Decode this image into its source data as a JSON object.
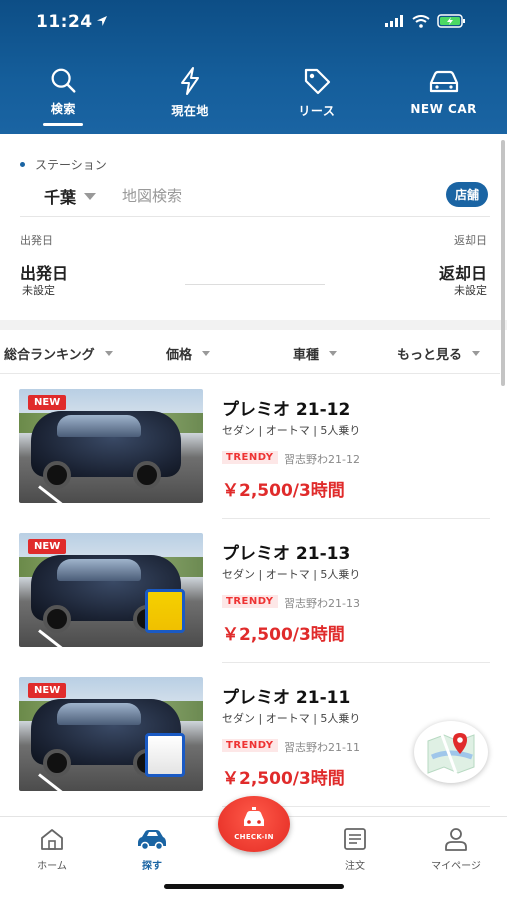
{
  "status_bar": {
    "time": "11:24"
  },
  "top_tabs": [
    {
      "label": "検索",
      "icon": "search-icon",
      "active": true
    },
    {
      "label": "現在地",
      "icon": "lightning-icon",
      "active": false
    },
    {
      "label": "リース",
      "icon": "tag-icon",
      "active": false
    },
    {
      "label": "NEW CAR",
      "icon": "car-icon",
      "active": false
    }
  ],
  "search": {
    "station_label": "ステーション",
    "city": "千葉",
    "map_search": "地図検索",
    "store_button": "店舗",
    "departure_label": "出発日",
    "return_label": "返却日",
    "departure_value": "出発日",
    "return_value": "返却日",
    "departure_sub": "未設定",
    "return_sub": "未設定"
  },
  "filters": [
    {
      "label": "総合ランキング"
    },
    {
      "label": "価格"
    },
    {
      "label": "車種"
    },
    {
      "label": "もっと見る"
    }
  ],
  "cars": [
    {
      "badge": "NEW",
      "name": "プレミオ 21-12",
      "spec": "セダン | オートマ | 5人乗り",
      "tag": "TRENDY",
      "plate": "習志野わ21-12",
      "price": "￥2,500/3時間",
      "stand": "none"
    },
    {
      "badge": "NEW",
      "name": "プレミオ 21-13",
      "spec": "セダン | オートマ | 5人乗り",
      "tag": "TRENDY",
      "plate": "習志野わ21-13",
      "price": "￥2,500/3時間",
      "stand": "yellow"
    },
    {
      "badge": "NEW",
      "name": "プレミオ 21-11",
      "spec": "セダン | オートマ | 5人乗り",
      "tag": "TRENDY",
      "plate": "習志野わ21-11",
      "price": "￥2,500/3時間",
      "stand": "white"
    }
  ],
  "bottom_nav": [
    {
      "label": "ホーム",
      "icon": "home-icon",
      "active": false
    },
    {
      "label": "探す",
      "icon": "car-icon",
      "active": true
    },
    {
      "label": "注文",
      "icon": "order-icon",
      "active": false
    },
    {
      "label": "マイページ",
      "icon": "person-icon",
      "active": false
    }
  ],
  "checkin": {
    "label": "CHECK-IN"
  },
  "colors": {
    "brand": "#1a64a3",
    "accent": "#e02b2b"
  }
}
